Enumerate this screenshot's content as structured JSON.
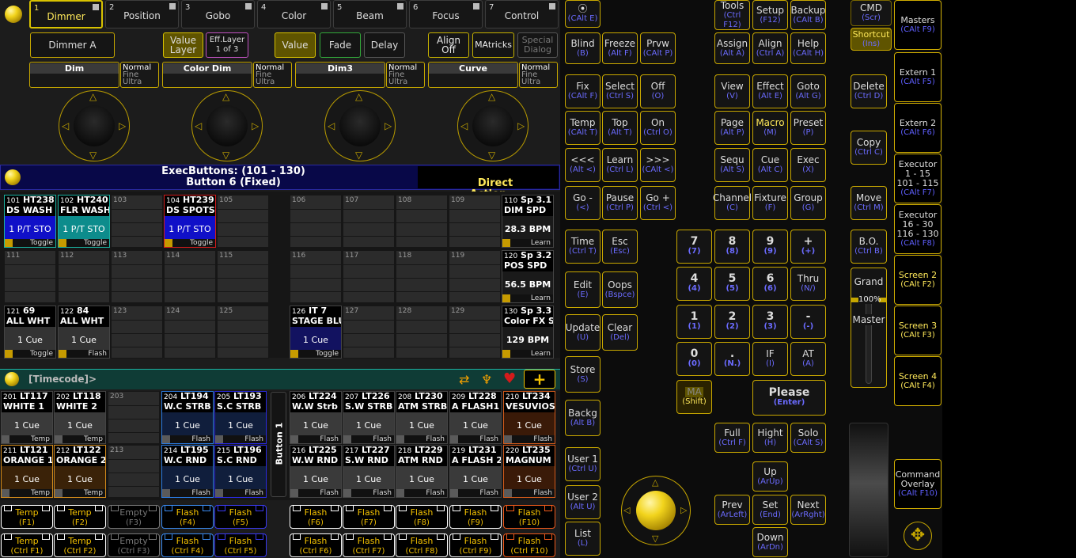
{
  "tabs": [
    {
      "num": "1",
      "label": "Dimmer"
    },
    {
      "num": "2",
      "label": "Position"
    },
    {
      "num": "3",
      "label": "Gobo"
    },
    {
      "num": "4",
      "label": "Color"
    },
    {
      "num": "5",
      "label": "Beam"
    },
    {
      "num": "6",
      "label": "Focus"
    },
    {
      "num": "7",
      "label": "Control"
    }
  ],
  "preset_row": {
    "feature": "Dimmer A",
    "value_layer": "Value\nLayer",
    "eff_layer": "Eff.Layer\n1 of 3",
    "value": "Value",
    "fade": "Fade",
    "delay": "Delay",
    "align": "Align\nOff",
    "matricks": "MAtricks",
    "special": "Special\nDialog"
  },
  "encoders": [
    {
      "name": "Dim",
      "mode1": "Normal",
      "mode2": "Fine",
      "mode3": "Ultra"
    },
    {
      "name": "Color Dim",
      "mode1": "Normal",
      "mode2": "Fine",
      "mode3": "Ultra"
    },
    {
      "name": "Dim3",
      "mode1": "Normal",
      "mode2": "Fine",
      "mode3": "Ultra"
    },
    {
      "name": "Curve",
      "mode1": "Normal",
      "mode2": "Fine",
      "mode3": "Ultra"
    }
  ],
  "exec_header": {
    "title": "ExecButtons: (101 - 130)",
    "subtitle": "Button  6 (Fixed)",
    "direct": "Direct\nAction"
  },
  "exec_grid": {
    "row1": [
      {
        "num": "101",
        "title": "HT238",
        "name": "DS WASH",
        "mid": "1 P/T STO",
        "foot": "Toggle"
      },
      {
        "num": "102",
        "title": "HT240",
        "name": "FLR WASH",
        "mid": "1 P/T STO",
        "foot": "Toggle"
      },
      {
        "num": "103"
      },
      {
        "num": "104",
        "title": "HT239",
        "name": "DS SPOTS",
        "mid": "1 P/T STO",
        "foot": "Toggle"
      },
      {
        "num": "105"
      },
      {
        "num": "106"
      },
      {
        "num": "107"
      },
      {
        "num": "108"
      },
      {
        "num": "109"
      },
      {
        "num": "110",
        "title": "Sp 3.1",
        "name": "DIM SPD",
        "mid": "28.3 BPM",
        "foot": "Learn"
      }
    ],
    "row2": [
      {
        "num": "111"
      },
      {
        "num": "112"
      },
      {
        "num": "113"
      },
      {
        "num": "114"
      },
      {
        "num": "115"
      },
      {
        "num": "116"
      },
      {
        "num": "117"
      },
      {
        "num": "118"
      },
      {
        "num": "119"
      },
      {
        "num": "120",
        "title": "Sp 3.2",
        "name": "POS SPD",
        "mid": "56.5 BPM",
        "foot": "Learn"
      }
    ],
    "row3": [
      {
        "num": "121",
        "title": "69",
        "name": "ALL WHT",
        "mid": "1 Cue",
        "foot": "Toggle"
      },
      {
        "num": "122",
        "title": "84",
        "name": "ALL WHT",
        "mid": "1 Cue",
        "foot": "Flash"
      },
      {
        "num": "123"
      },
      {
        "num": "124"
      },
      {
        "num": "125"
      },
      {
        "num": "126",
        "title": "IT   7",
        "name": "STAGE BLU",
        "mid": "1 Cue",
        "foot": "Toggle"
      },
      {
        "num": "127"
      },
      {
        "num": "128"
      },
      {
        "num": "129"
      },
      {
        "num": "130",
        "title": "Sp 3.3",
        "name": "Color FX S",
        "mid": "129 BPM",
        "foot": "Learn"
      }
    ]
  },
  "timecode_label": "[Timecode]>",
  "bottom_exec": {
    "side_label": "Button  1",
    "row1": [
      {
        "num": "201",
        "title": "LT117",
        "name": "WHITE 1",
        "mid": "1 Cue",
        "foot": "Temp"
      },
      {
        "num": "202",
        "title": "LT118",
        "name": "WHITE 2",
        "mid": "1 Cue",
        "foot": "Temp"
      },
      {
        "num": "203"
      },
      {
        "num": "204",
        "title": "LT194",
        "name": "W.C STRB",
        "mid": "1 Cue",
        "foot": "Flash"
      },
      {
        "num": "205",
        "title": "LT193",
        "name": "S.C STRB",
        "mid": "1 Cue",
        "foot": "Flash"
      },
      {
        "num": "206",
        "title": "LT224",
        "name": "W.W Strb",
        "mid": "1 Cue",
        "foot": "Flash"
      },
      {
        "num": "207",
        "title": "LT226",
        "name": "S.W STRB",
        "mid": "1 Cue",
        "foot": "Flash"
      },
      {
        "num": "208",
        "title": "LT230",
        "name": "ATM STRB",
        "mid": "1 Cue",
        "foot": "Flash"
      },
      {
        "num": "209",
        "title": "LT228",
        "name": "A FLASH1",
        "mid": "1 Cue",
        "foot": "Flash"
      },
      {
        "num": "210",
        "title": "LT234",
        "name": "VESUVIOS",
        "mid": "1 Cue",
        "foot": "Flash"
      }
    ],
    "row2": [
      {
        "num": "211",
        "title": "LT121",
        "name": "ORANGE 1",
        "mid": "1 Cue",
        "foot": "Temp"
      },
      {
        "num": "212",
        "title": "LT122",
        "name": "ORANGE 2",
        "mid": "1 Cue",
        "foot": "Temp"
      },
      {
        "num": "213"
      },
      {
        "num": "214",
        "title": "LT195",
        "name": "W.C RND",
        "mid": "1 Cue",
        "foot": "Flash"
      },
      {
        "num": "215",
        "title": "LT196",
        "name": "S.C RND",
        "mid": "1 Cue",
        "foot": "Flash"
      },
      {
        "num": "216",
        "title": "LT225",
        "name": "W.W RND",
        "mid": "1 Cue",
        "foot": "Flash"
      },
      {
        "num": "217",
        "title": "LT227",
        "name": "S.W RND",
        "mid": "1 Cue",
        "foot": "Flash"
      },
      {
        "num": "218",
        "title": "LT229",
        "name": "ATM RND",
        "mid": "1 Cue",
        "foot": "Flash"
      },
      {
        "num": "219",
        "title": "LT231",
        "name": "A FLASH 2",
        "mid": "1 Cue",
        "foot": "Flash"
      },
      {
        "num": "220",
        "title": "LT235",
        "name": "MAGNUM",
        "mid": "1 Cue",
        "foot": "Flash"
      }
    ]
  },
  "fbuttons_row1": [
    {
      "label": "Temp",
      "key": "(F1)"
    },
    {
      "label": "Temp",
      "key": "(F2)"
    },
    {
      "label": "Empty",
      "key": "(F3)"
    },
    {
      "label": "Flash",
      "key": "(F4)"
    },
    {
      "label": "Flash",
      "key": "(F5)"
    },
    {
      "label": "Flash",
      "key": "(F6)"
    },
    {
      "label": "Flash",
      "key": "(F7)"
    },
    {
      "label": "Flash",
      "key": "(F8)"
    },
    {
      "label": "Flash",
      "key": "(F9)"
    },
    {
      "label": "Flash",
      "key": "(F10)"
    }
  ],
  "fbuttons_row2": [
    {
      "label": "Temp",
      "key": "(Ctrl F1)"
    },
    {
      "label": "Temp",
      "key": "(Ctrl F2)"
    },
    {
      "label": "Empty",
      "key": "(Ctrl F3)"
    },
    {
      "label": "Flash",
      "key": "(Ctrl F4)"
    },
    {
      "label": "Flash",
      "key": "(Ctrl F5)"
    },
    {
      "label": "Flash",
      "key": "(Ctrl F6)"
    },
    {
      "label": "Flash",
      "key": "(Ctrl F7)"
    },
    {
      "label": "Flash",
      "key": "(Ctrl F8)"
    },
    {
      "label": "Flash",
      "key": "(Ctrl F9)"
    },
    {
      "label": "Flash",
      "key": "(Ctrl F10)"
    }
  ],
  "keys": {
    "ctl_e": {
      "m": "⦿",
      "s": "(CAlt E)"
    },
    "blind": {
      "m": "Blind",
      "s": "(B)"
    },
    "freeze": {
      "m": "Freeze",
      "s": "(Alt F)"
    },
    "prvw": {
      "m": "Prvw",
      "s": "(CAlt P)"
    },
    "fix": {
      "m": "Fix",
      "s": "(CAlt F)"
    },
    "select": {
      "m": "Select",
      "s": "(Ctrl S)"
    },
    "off": {
      "m": "Off",
      "s": "(O)"
    },
    "temp": {
      "m": "Temp",
      "s": "(CAlt T)"
    },
    "top": {
      "m": "Top",
      "s": "(Alt T)"
    },
    "on": {
      "m": "On",
      "s": "(Ctrl O)"
    },
    "back": {
      "m": "<<<",
      "s": "(Alt <)"
    },
    "learn": {
      "m": "Learn",
      "s": "(Ctrl L)"
    },
    "fwd": {
      "m": ">>>",
      "s": "(CAlt <)"
    },
    "gominus": {
      "m": "Go -",
      "s": "(<)"
    },
    "pause": {
      "m": "Pause",
      "s": "(Ctrl P)"
    },
    "goplus": {
      "m": "Go +",
      "s": "(Ctrl <)"
    },
    "time": {
      "m": "Time",
      "s": "(Ctrl T)"
    },
    "esc": {
      "m": "Esc",
      "s": "(Esc)"
    },
    "edit": {
      "m": "Edit",
      "s": "(E)"
    },
    "oops": {
      "m": "Oops",
      "s": "(Bspce)"
    },
    "update": {
      "m": "Update",
      "s": "(U)"
    },
    "clear": {
      "m": "Clear",
      "s": "(Del)"
    },
    "store": {
      "m": "Store",
      "s": "(S)"
    },
    "backg": {
      "m": "Backg",
      "s": "(Alt B)"
    },
    "user1": {
      "m": "User 1",
      "s": "(Ctrl U)"
    },
    "user2": {
      "m": "User 2",
      "s": "(Alt U)"
    },
    "list": {
      "m": "List",
      "s": "(L)"
    },
    "tools": {
      "m": "Tools",
      "s": "(Ctrl F12)"
    },
    "setup": {
      "m": "Setup",
      "s": "(F12)"
    },
    "backup": {
      "m": "Backup",
      "s": "(CAlt B)"
    },
    "assign": {
      "m": "Assign",
      "s": "(Alt A)"
    },
    "align": {
      "m": "Align",
      "s": "(Ctrl A)"
    },
    "help": {
      "m": "Help",
      "s": "(CAlt H)"
    },
    "view": {
      "m": "View",
      "s": "(V)"
    },
    "effect": {
      "m": "Effect",
      "s": "(Alt E)"
    },
    "goto": {
      "m": "Goto",
      "s": "(Alt G)"
    },
    "page": {
      "m": "Page",
      "s": "(Alt P)"
    },
    "macro": {
      "m": "Macro",
      "s": "(M)"
    },
    "preset": {
      "m": "Preset",
      "s": "(P)"
    },
    "sequ": {
      "m": "Sequ",
      "s": "(Alt S)"
    },
    "cue": {
      "m": "Cue",
      "s": "(Alt C)"
    },
    "exec": {
      "m": "Exec",
      "s": "(X)"
    },
    "channel": {
      "m": "Channel",
      "s": "(C)"
    },
    "fixture": {
      "m": "Fixture",
      "s": "(F)"
    },
    "group": {
      "m": "Group",
      "s": "(G)"
    },
    "k7": {
      "m": "7",
      "s": "(7)"
    },
    "k8": {
      "m": "8",
      "s": "(8)"
    },
    "k9": {
      "m": "9",
      "s": "(9)"
    },
    "kplus": {
      "m": "+",
      "s": "(+)"
    },
    "k4": {
      "m": "4",
      "s": "(4)"
    },
    "k5": {
      "m": "5",
      "s": "(5)"
    },
    "k6": {
      "m": "6",
      "s": "(6)"
    },
    "thru": {
      "m": "Thru",
      "s": "(N/)"
    },
    "k1": {
      "m": "1",
      "s": "(1)"
    },
    "k2": {
      "m": "2",
      "s": "(2)"
    },
    "k3": {
      "m": "3",
      "s": "(3)"
    },
    "kminus": {
      "m": "-",
      "s": "(-)"
    },
    "k0": {
      "m": "0",
      "s": "(0)"
    },
    "kdot": {
      "m": ".",
      "s": "(N.)"
    },
    "kif": {
      "m": "IF",
      "s": "(I)"
    },
    "kat": {
      "m": "AT",
      "s": "(A)"
    },
    "ma": {
      "m": "MA",
      "s": "(Shift)"
    },
    "please": {
      "m": "Please",
      "s": "(Enter)"
    },
    "full": {
      "m": "Full",
      "s": "(Ctrl F)"
    },
    "hight": {
      "m": "Hight",
      "s": "(H)"
    },
    "solo": {
      "m": "Solo",
      "s": "(CAlt S)"
    },
    "up": {
      "m": "Up",
      "s": "(ArUp)"
    },
    "prev": {
      "m": "Prev",
      "s": "(ArLeft)"
    },
    "set": {
      "m": "Set",
      "s": "(End)"
    },
    "next": {
      "m": "Next",
      "s": "(ArRght)"
    },
    "down": {
      "m": "Down",
      "s": "(ArDn)"
    },
    "cmd": {
      "m": "CMD",
      "s": "(Scr)"
    },
    "shortcut": {
      "m": "Shortcut",
      "s": "(Ins)"
    },
    "delete": {
      "m": "Delete",
      "s": "(Ctrl D)"
    },
    "copy": {
      "m": "Copy",
      "s": "(Ctrl C)"
    },
    "move": {
      "m": "Move",
      "s": "(Ctrl M)"
    },
    "bo": {
      "m": "B.O.",
      "s": "(Ctrl B)"
    },
    "grand": "Grand",
    "grand_level": "100%",
    "master": "Master"
  },
  "screen_column": {
    "masters": {
      "m": "Masters",
      "s": "(CAlt F9)"
    },
    "extern1": {
      "m": "Extern 1",
      "s": "(CAlt F5)"
    },
    "extern2": {
      "m": "Extern 2",
      "s": "(CAlt F6)"
    },
    "executor1": {
      "m": "Executor\n1 - 15\n101 - 115",
      "s": "(CAlt F7)"
    },
    "executor2": {
      "m": "Executor\n16 - 30\n116 - 130",
      "s": "(CAlt F8)"
    },
    "screen2": {
      "m": "Screen 2",
      "s": "(CAlt F2)"
    },
    "screen3": {
      "m": "Screen 3",
      "s": "(CAlt F3)"
    },
    "screen4": {
      "m": "Screen 4",
      "s": "(CAlt F4)"
    },
    "overlay": {
      "m": "Command\nOverlay",
      "s": "(CAlt F10)"
    }
  },
  "colors": {
    "accent": "#d8c200",
    "blue_key": "#6b6bff",
    "exec_blue": "#1010c8",
    "red": "#d21b1b",
    "green": "#1bb1a0"
  }
}
